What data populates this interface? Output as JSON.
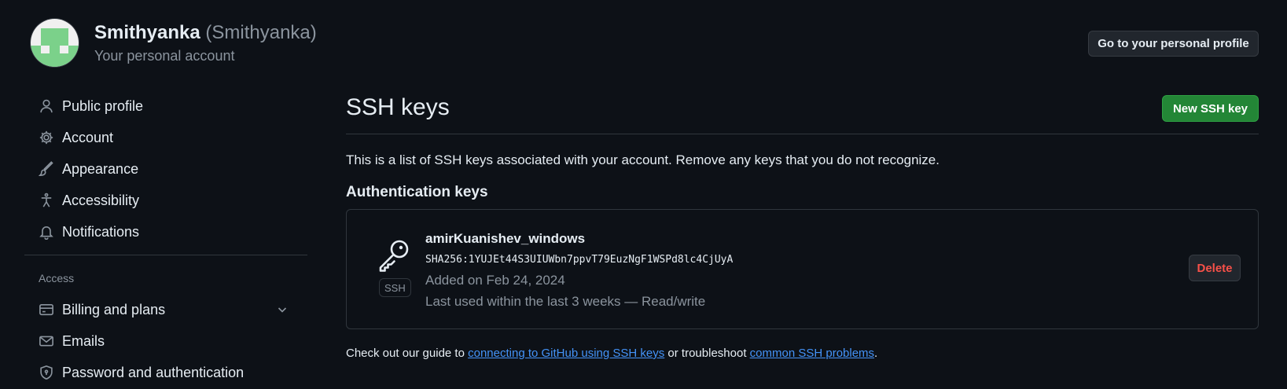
{
  "account": {
    "name": "Smithyanka",
    "login": "(Smithyanka)",
    "subtitle": "Your personal account",
    "profile_button": "Go to your personal profile"
  },
  "sidebar": {
    "items": [
      {
        "label": "Public profile",
        "icon": "person-icon"
      },
      {
        "label": "Account",
        "icon": "gear-icon"
      },
      {
        "label": "Appearance",
        "icon": "paintbrush-icon"
      },
      {
        "label": "Accessibility",
        "icon": "accessibility-icon"
      },
      {
        "label": "Notifications",
        "icon": "bell-icon"
      }
    ],
    "access_group_label": "Access",
    "access_items": [
      {
        "label": "Billing and plans",
        "icon": "credit-card-icon",
        "expandable": true
      },
      {
        "label": "Emails",
        "icon": "mail-icon"
      },
      {
        "label": "Password and authentication",
        "icon": "shield-lock-icon"
      }
    ]
  },
  "main": {
    "title": "SSH keys",
    "new_key_button": "New SSH key",
    "intro": "This is a list of SSH keys associated with your account. Remove any keys that you do not recognize.",
    "section_title": "Authentication keys",
    "keys": [
      {
        "title": "amirKuanishev_windows",
        "fingerprint": "SHA256:1YUJEt44S3UIUWbn7ppvT79EuzNgF1WSPd8lc4CjUyA",
        "added": "Added on Feb 24, 2024",
        "last_used": "Last used within the last 3 weeks — Read/write",
        "type_badge": "SSH",
        "delete_label": "Delete"
      }
    ],
    "footer": {
      "prefix": "Check out our guide to ",
      "link1": "connecting to GitHub using SSH keys",
      "middle": " or troubleshoot ",
      "link2": "common SSH problems",
      "suffix": "."
    }
  },
  "colors": {
    "background": "#0d1117",
    "text": "#e6edf3",
    "muted": "#8b949e",
    "border": "#30363d",
    "primary_button": "#238636",
    "danger": "#f85149",
    "link": "#4493f8"
  }
}
